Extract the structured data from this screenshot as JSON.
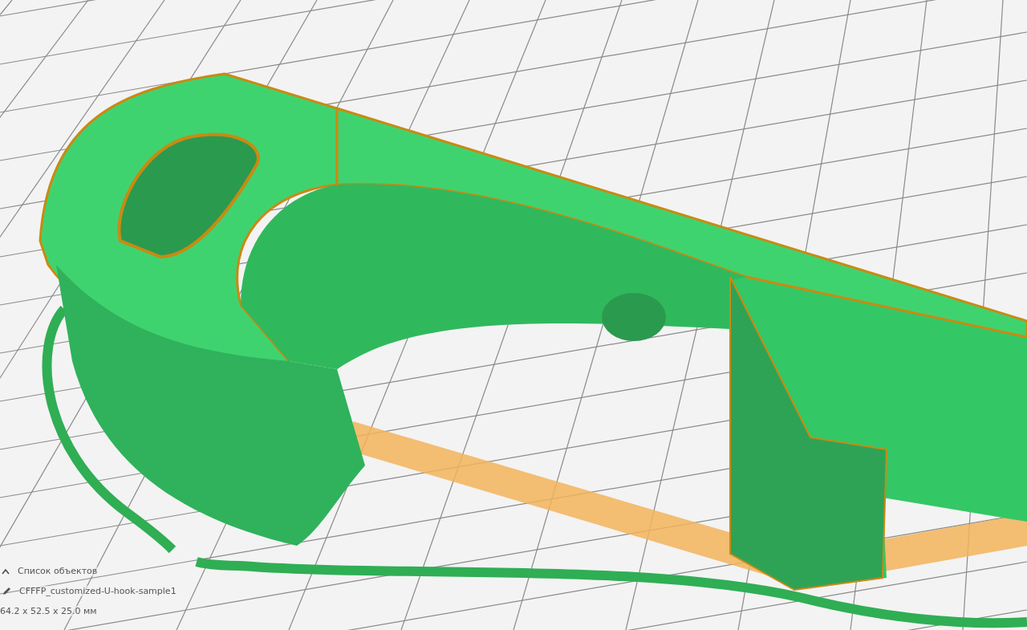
{
  "object_list": {
    "label": "Список объектов"
  },
  "object": {
    "name": "CFFFP_customized-U-hook-sample1"
  },
  "dimensions": "64.2 x 52.5 x 25.0 мм"
}
